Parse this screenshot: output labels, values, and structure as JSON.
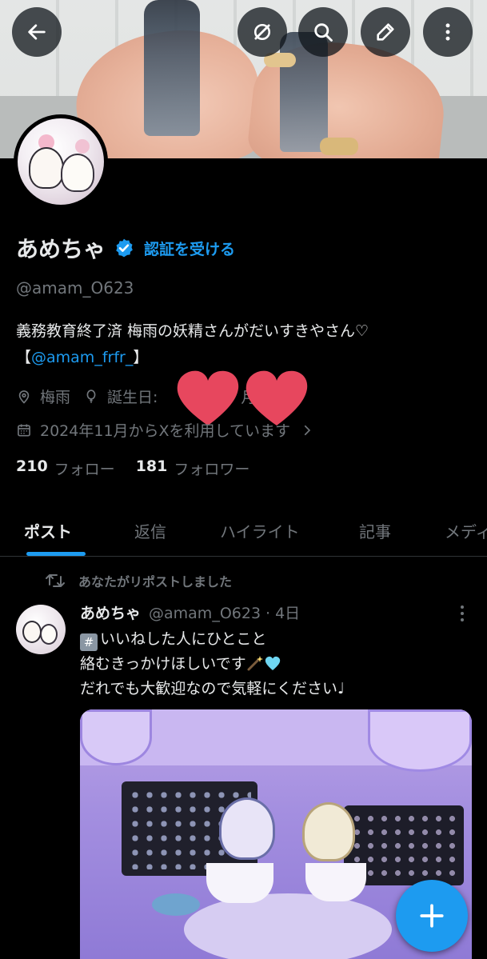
{
  "profile": {
    "display_name": "あめちゃ",
    "verify_link": "認証を受ける",
    "handle": "@amam_O623",
    "bio_line1": "義務教育終了済 梅雨の妖精さんがだいすきやさん♡",
    "bio_line2_open": "【",
    "bio_mention": "@amam_frfr_",
    "bio_line2_close": "】",
    "location": "梅雨",
    "birthday_label": "誕生日:",
    "birthday_visible_fragment": "月",
    "joined": "2024年11月からXを利用しています",
    "following_count": "210",
    "following_label": "フォロー",
    "followers_count": "181",
    "followers_label": "フォロワー"
  },
  "tabs": [
    {
      "label": "ポスト",
      "active": true
    },
    {
      "label": "返信",
      "active": false
    },
    {
      "label": "ハイライト",
      "active": false
    },
    {
      "label": "記事",
      "active": false
    },
    {
      "label": "メディ",
      "active": false
    }
  ],
  "post": {
    "repost_note": "あなたがリポストしました",
    "author_name": "あめちゃ",
    "author_handle": "@amam_O623",
    "separator": "·",
    "time": "4日",
    "hashtag_symbol": "#",
    "line1": "いいねした人にひとこと",
    "line2": "絡むきっかけほしいです",
    "line3": "だれでも大歓迎なので気軽にください♩"
  },
  "icons": {
    "back": "arrow-left-icon",
    "grok": "grok-icon",
    "search": "search-icon",
    "edit": "pencil-icon",
    "more": "more-vertical-icon",
    "verified": "verified-badge-icon",
    "location": "location-pin-icon",
    "birthday": "balloon-icon",
    "calendar": "calendar-icon",
    "chevron": "chevron-right-icon",
    "repost": "repost-icon",
    "compose": "plus-icon"
  },
  "colors": {
    "accent": "#1d9bf0",
    "background": "#000000",
    "text_primary": "#e7e9ea",
    "text_secondary": "#71767b",
    "sticker_heart": "#e7475e"
  }
}
